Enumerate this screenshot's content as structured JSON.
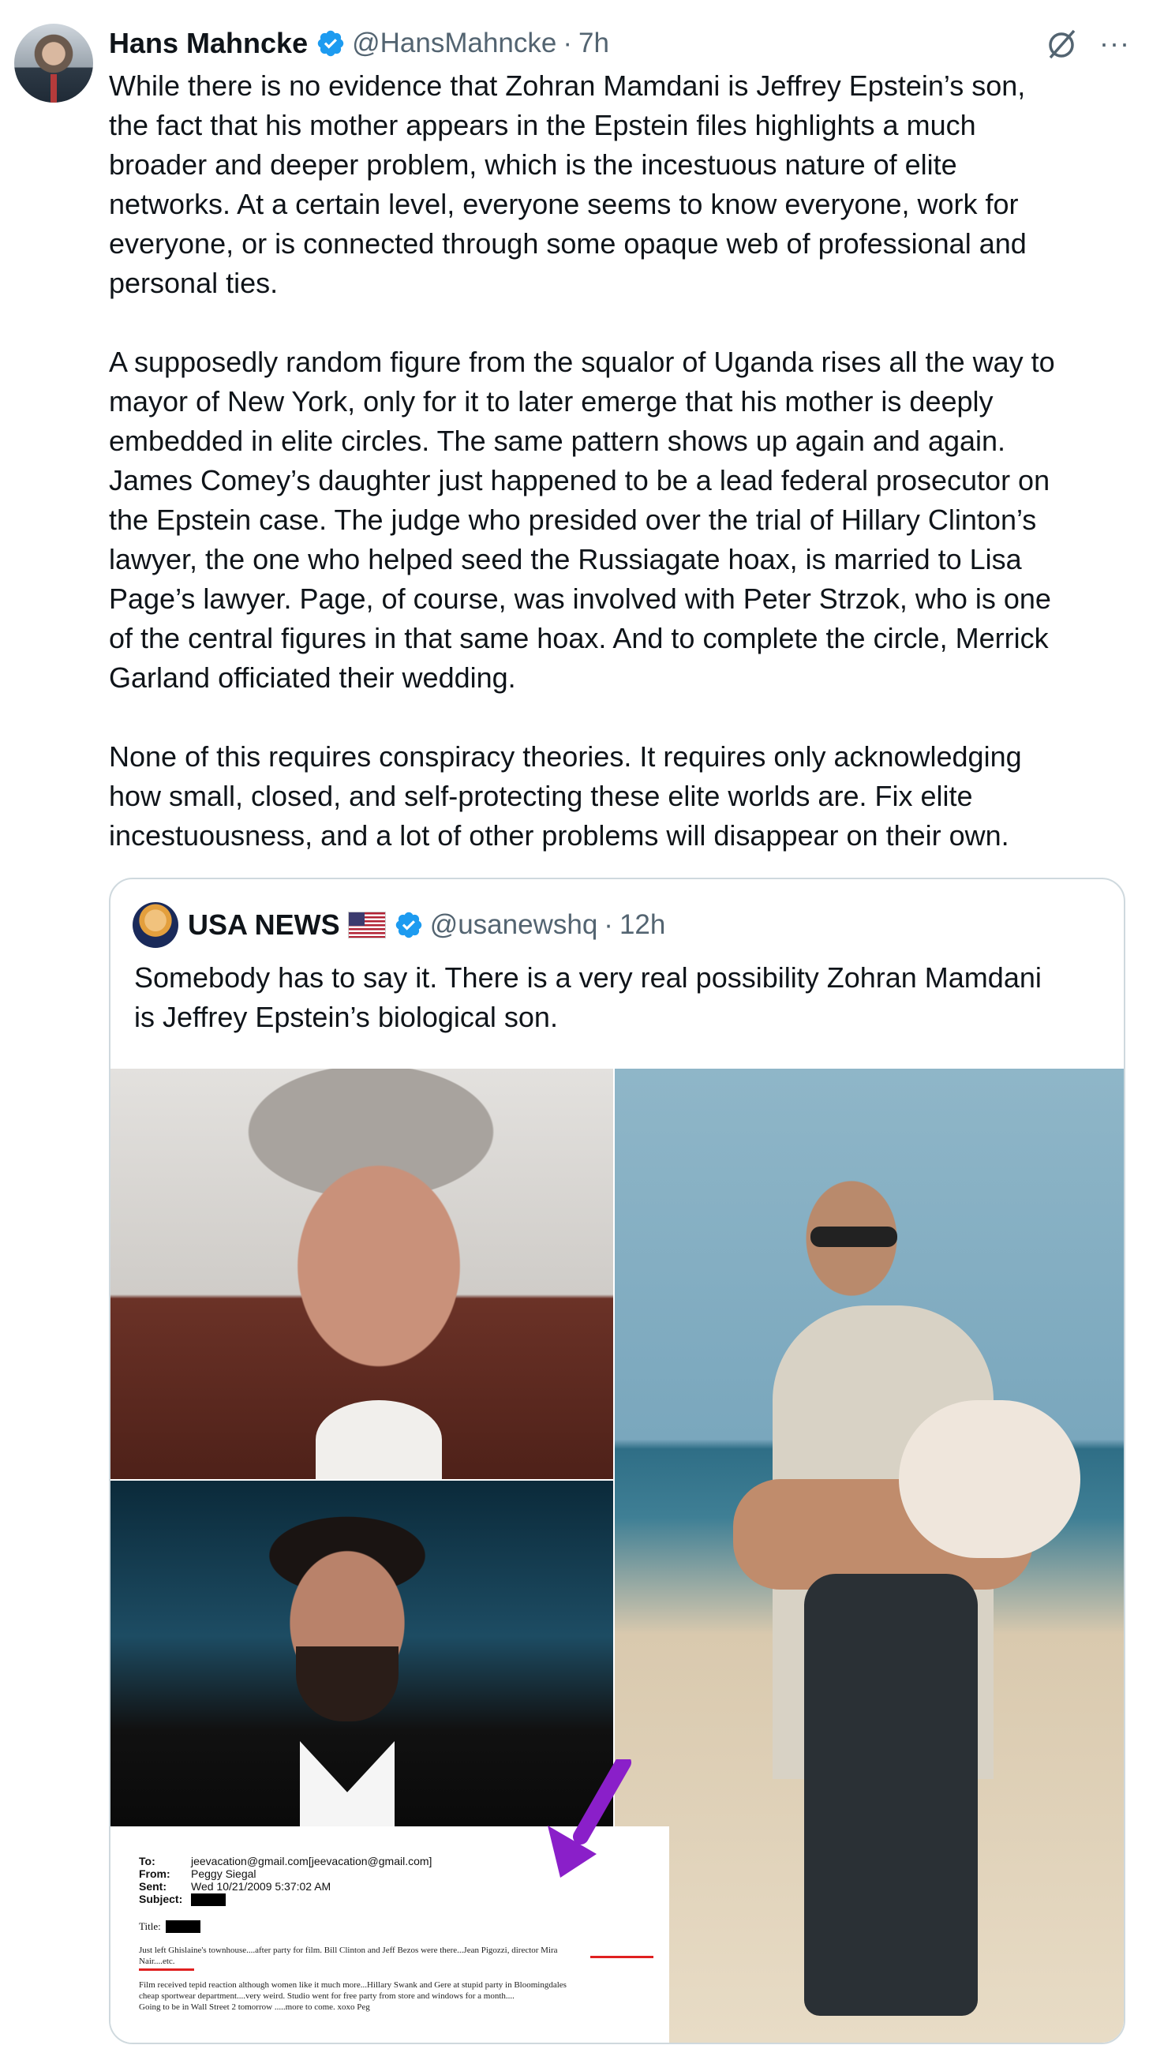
{
  "post": {
    "author_name": "Hans Mahncke",
    "handle": "@HansMahncke",
    "separator": "·",
    "time": "7h",
    "more_label": "···",
    "paragraphs": [
      "While there is no evidence that Zohran Mamdani is Jeffrey Epstein’s son,\nthe fact that his mother appears in the Epstein files highlights a much\nbroader and deeper problem, which is the incestuous nature of elite\nnetworks. At a certain level, everyone seems to know everyone, work for\neveryone, or is connected through some opaque web of professional and\npersonal ties.",
      "A supposedly random figure from the squalor of Uganda rises all the way to\nmayor of New York, only for it to later emerge that his mother is deeply\nembedded in elite circles. The same pattern shows up again and again.\nJames Comey’s daughter just happened to be a lead federal prosecutor on\nthe Epstein case. The judge who presided over the trial of Hillary Clinton’s\nlawyer, the one who helped seed the Russiagate hoax, is married to Lisa\nPage’s lawyer. Page, of course, was involved with Peter Strzok, who is one\nof the central figures in that same hoax. And to complete the circle, Merrick\nGarland officiated their wedding.",
      "None of this requires conspiracy theories. It requires only acknowledging\nhow small, closed, and self-protecting these elite worlds are. Fix elite\nincestuousness, and a lot of other problems will disappear on their own."
    ]
  },
  "quote": {
    "author_name": "USA NEWS",
    "handle": "@usanewshq",
    "separator": "·",
    "time": "12h",
    "text": "Somebody has to say it. There is a very real possibility Zohran Mamdani\nis Jeffrey Epstein’s biological son.",
    "document": {
      "to_key": "To:",
      "to_val": "jeevacation@gmail.com[jeevacation@gmail.com]",
      "from_key": "From:",
      "from_val": "Peggy Siegal",
      "sent_key": "Sent:",
      "sent_val": "Wed 10/21/2009 5:37:02 AM",
      "subject_key": "Subject:",
      "title_key": "Title:",
      "line1": "Just left Ghislaine's townhouse....after party for film.  Bill Clinton and Jeff Bezos were there...Jean Pigozzi, director Mira",
      "line2": "Nair....etc.",
      "line3": "Film received tepid reaction although women like it much more...Hillary Swank and Gere at stupid party in Bloomingdales",
      "line4": "cheap sportwear department....very weird.  Studio went for free party from store and windows for a month....",
      "line5": "Going to be in Wall Street 2 tomorrow .....more to come. xoxo Peg"
    }
  },
  "colors": {
    "verified": "#1d9bf0",
    "secondary_text": "#536471",
    "border": "#cfd9de",
    "arrow": "#8a1fc9",
    "underline": "#e02020"
  }
}
